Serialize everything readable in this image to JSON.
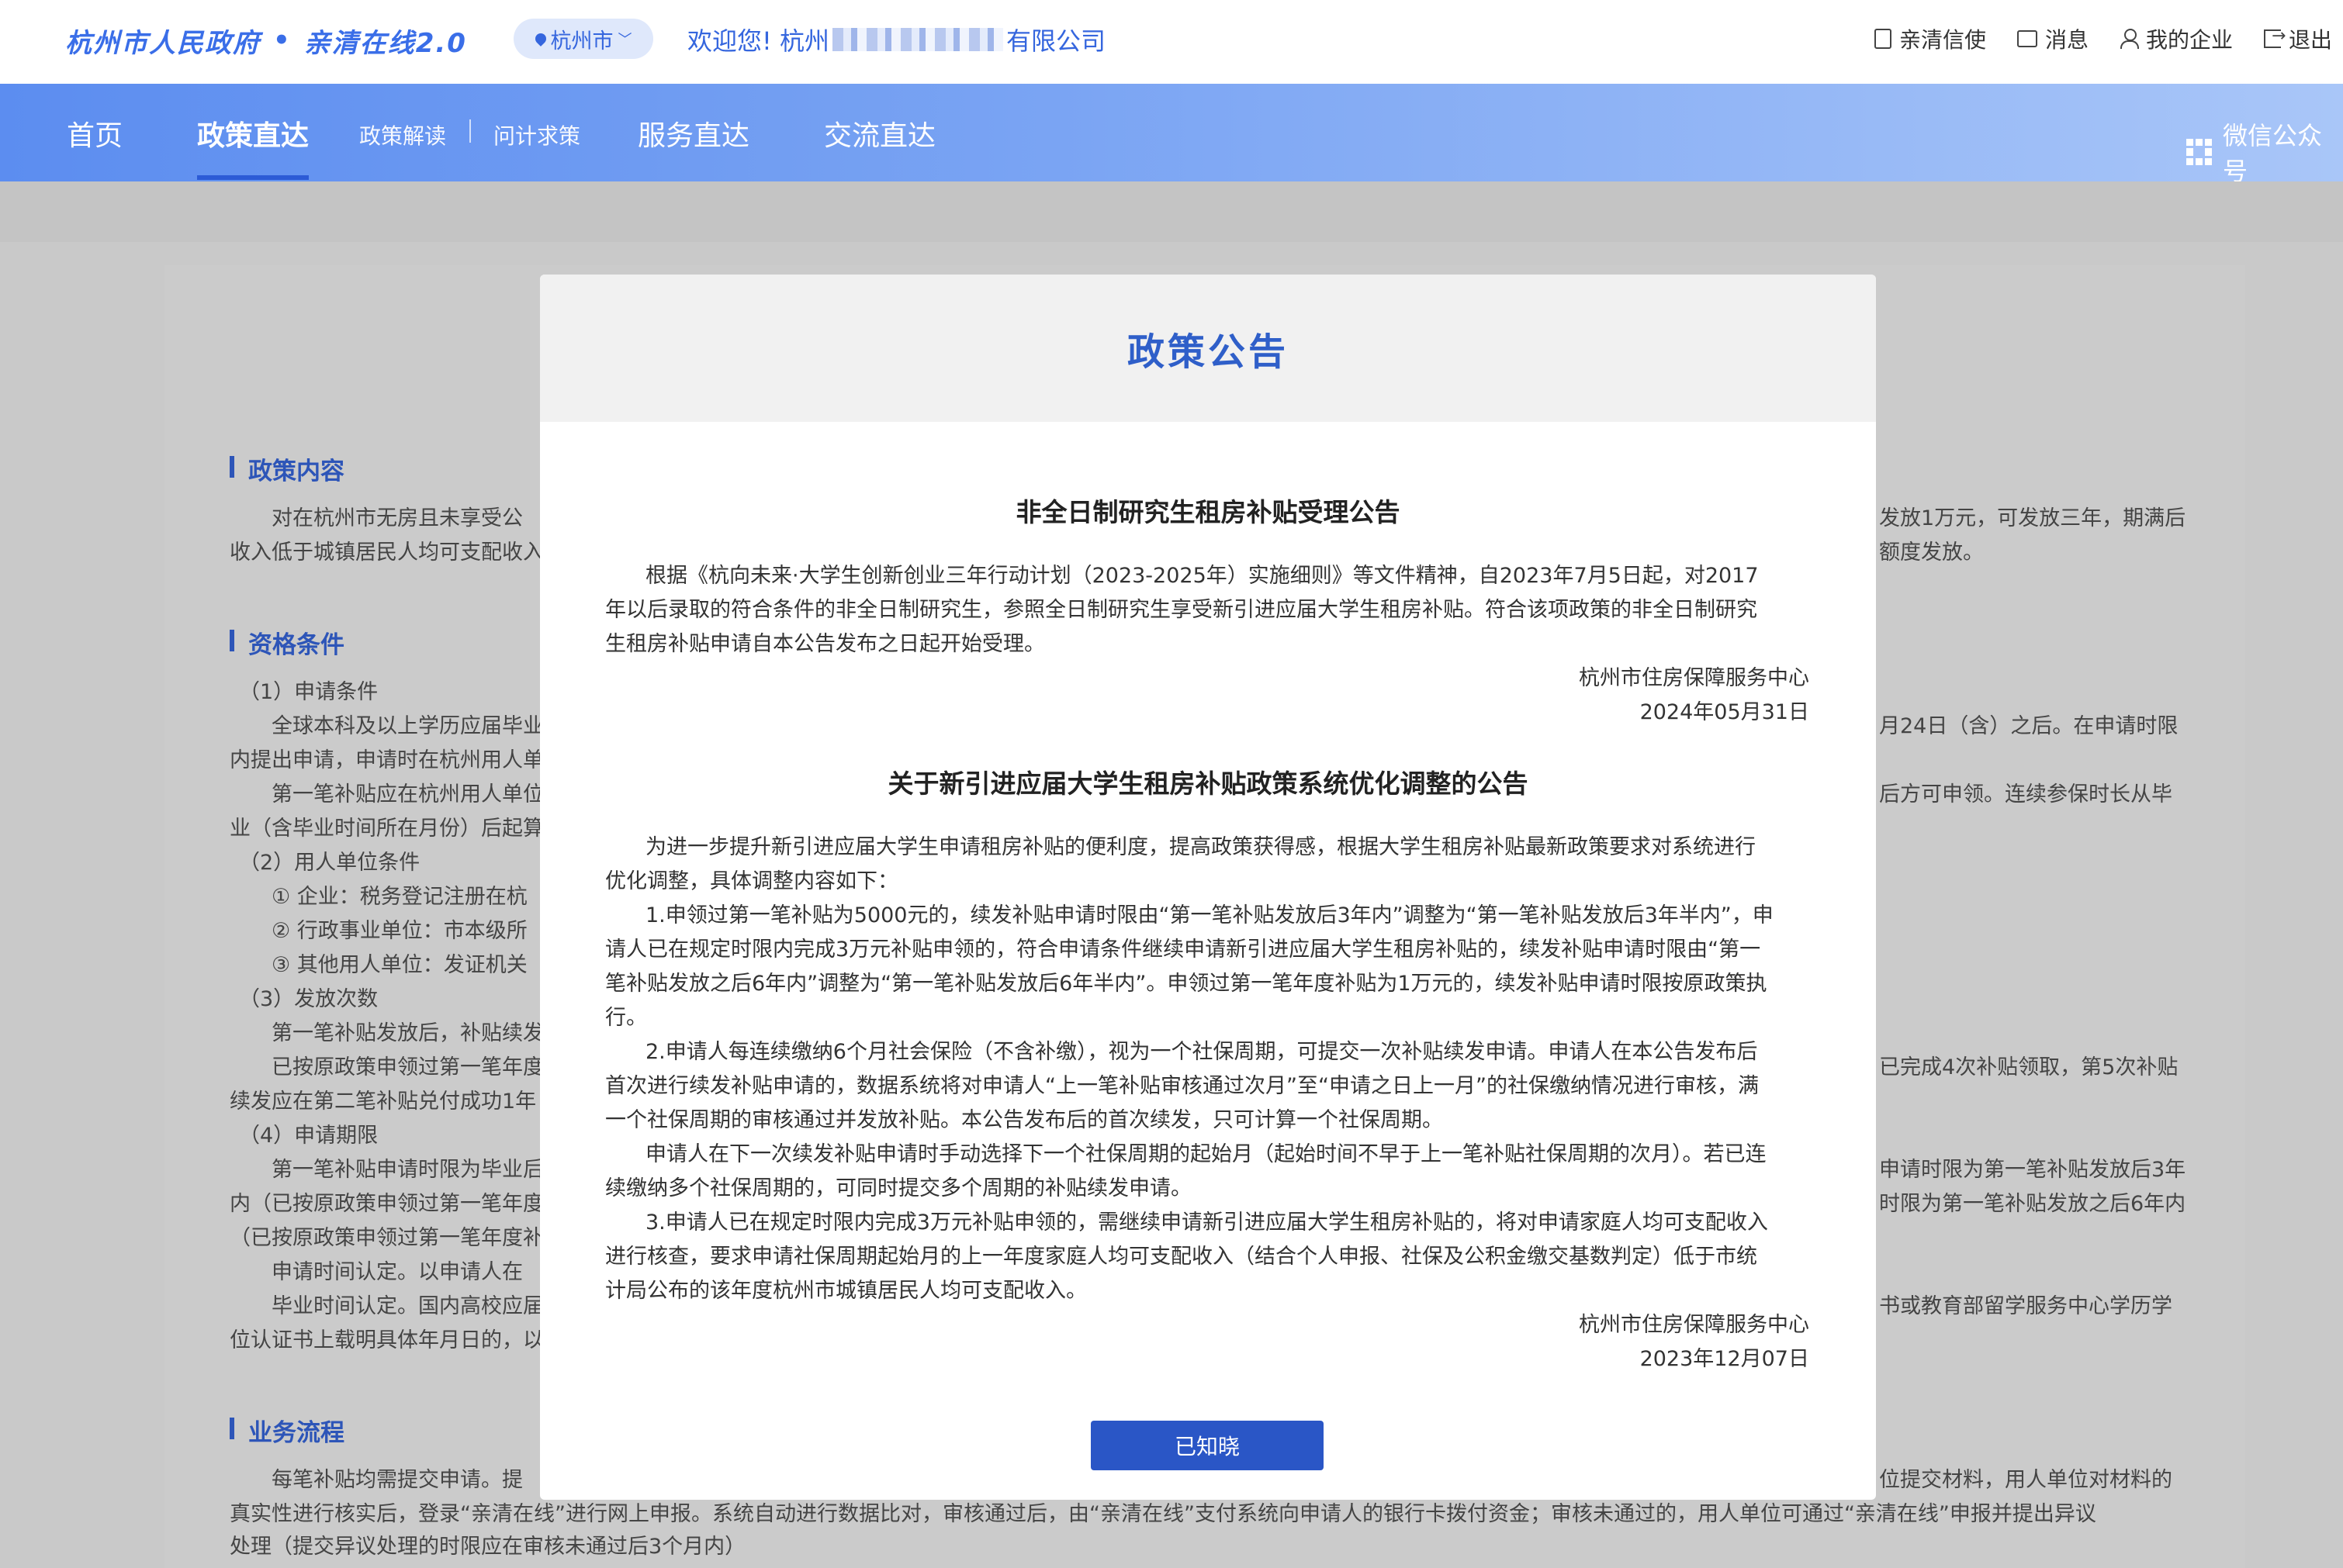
{
  "header": {
    "brand_left": "杭州市人民政府",
    "brand_right": "亲清在线2.0",
    "city": "杭州市",
    "welcome_prefix": "欢迎您! 杭州",
    "welcome_suffix": "有限公司",
    "actions": [
      "亲清信使",
      "消息",
      "我的企业",
      "退出"
    ]
  },
  "nav": {
    "home": "首页",
    "policy": "政策直达",
    "policy_interpret": "政策解读",
    "policy_ask": "问计求策",
    "service": "服务直达",
    "exchange": "交流直达",
    "wechat": "微信公众号"
  },
  "background_page": {
    "sections": [
      {
        "title": "政策内容",
        "lines": [
          "对在杭州市无房且未享受公",
          "收入低于城镇居民人均可支配收入",
          "发放1万元，可发放三年，期满后",
          "额度发放。"
        ]
      },
      {
        "title": "资格条件",
        "lines": [
          "（1）申请条件",
          "全球本科及以上学历应届毕业",
          "内提出申请，申请时在杭州用人单",
          "第一笔补贴应在杭州用人单位",
          "业（含毕业时间所在月份）后起算",
          "（2）用人单位条件",
          "① 企业：税务登记注册在杭",
          "② 行政事业单位：市本级所",
          "③ 其他用人单位：发证机关",
          "（3）发放次数",
          "第一笔补贴发放后，补贴续发",
          "已按原政策申领过第一笔年度",
          "续发应在第二笔补贴兑付成功1年",
          "（4）申请期限",
          "第一笔补贴申请时限为毕业后",
          "内（已按原政策申领过第一笔年度",
          "（已按原政策申领过第一笔年度补",
          "申请时间认定。以申请人在",
          "毕业时间认定。国内高校应届",
          "位认证书上载明具体年月日的，以",
          "月24日（含）之后。在申请时限",
          "后方可申领。连续参保时长从毕",
          "已完成4次补贴领取，第5次补贴",
          "申请时限为第一笔补贴发放后3年",
          "时限为第一笔补贴发放之后6年内",
          "书或教育部留学服务中心学历学"
        ]
      },
      {
        "title": "业务流程",
        "lines": [
          "每笔补贴均需提交申请。提",
          "位提交材料，用人单位对材料的",
          "真实性进行核实后，登录“亲清在线”进行网上申报。系统自动进行数据比对，审核通过后，由“亲清在线”支付系统向申请人的银行卡拨付资金；审核未通过的，用人单位可通过“亲清在线”申报并提出异议",
          "处理（提交异议处理的时限应在审核未通过后3个月内）"
        ]
      }
    ]
  },
  "modal": {
    "title": "政策公告",
    "notices": [
      {
        "title": "非全日制研究生租房补贴受理公告",
        "paragraphs": [
          "根据《杭向未来·大学生创新创业三年行动计划（2023-2025年）实施细则》等文件精神，自2023年7月5日起，对2017",
          "年以后录取的符合条件的非全日制研究生，参照全日制研究生享受新引进应届大学生租房补贴。符合该项政策的非全日制研究",
          "生租房补贴申请自本公告发布之日起开始受理。"
        ],
        "signature": "杭州市住房保障服务中心",
        "date": "2024年05月31日"
      },
      {
        "title": "关于新引进应届大学生租房补贴政策系统优化调整的公告",
        "paragraphs": [
          "为进一步提升新引进应届大学生申请租房补贴的便利度，提高政策获得感，根据大学生租房补贴最新政策要求对系统进行",
          "优化调整，具体调整内容如下：",
          "1.申领过第一笔补贴为5000元的，续发补贴申请时限由“第一笔补贴发放后3年内”调整为“第一笔补贴发放后3年半内”，申",
          "请人已在规定时限内完成3万元补贴申领的，符合申请条件继续申请新引进应届大学生租房补贴的，续发补贴申请时限由“第一",
          "笔补贴发放之后6年内”调整为“第一笔补贴发放后6年半内”。申领过第一笔年度补贴为1万元的，续发补贴申请时限按原政策执",
          "行。",
          "2.申请人每连续缴纳6个月社会保险（不含补缴），视为一个社保周期，可提交一次补贴续发申请。申请人在本公告发布后",
          "首次进行续发补贴申请的，数据系统将对申请人“上一笔补贴审核通过次月”至“申请之日上一月”的社保缴纳情况进行审核，满",
          "一个社保周期的审核通过并发放补贴。本公告发布后的首次续发，只可计算一个社保周期。",
          "申请人在下一次续发补贴申请时手动选择下一个社保周期的起始月（起始时间不早于上一笔补贴社保周期的次月）。若已连",
          "续缴纳多个社保周期的，可同时提交多个周期的补贴续发申请。",
          "3.申请人已在规定时限内完成3万元补贴申领的，需继续申请新引进应届大学生租房补贴的，将对申请家庭人均可支配收入",
          "进行核查，要求申请社保周期起始月的上一年度家庭人均可支配收入（结合个人申报、社保及公积金缴交基数判定）低于市统",
          "计局公布的该年度杭州市城镇居民人均可支配收入。"
        ],
        "signature": "杭州市住房保障服务中心",
        "date": "2023年12月07日"
      }
    ],
    "confirm_button": "已知晓"
  },
  "colors": {
    "brand_blue": "#3a6ee8",
    "nav_gradient_start": "#5c8df0",
    "nav_gradient_end": "#a9c6f8",
    "modal_title": "#2f5fc9",
    "button": "#2a56c6",
    "overlay_gray": "#c9c9c9"
  }
}
